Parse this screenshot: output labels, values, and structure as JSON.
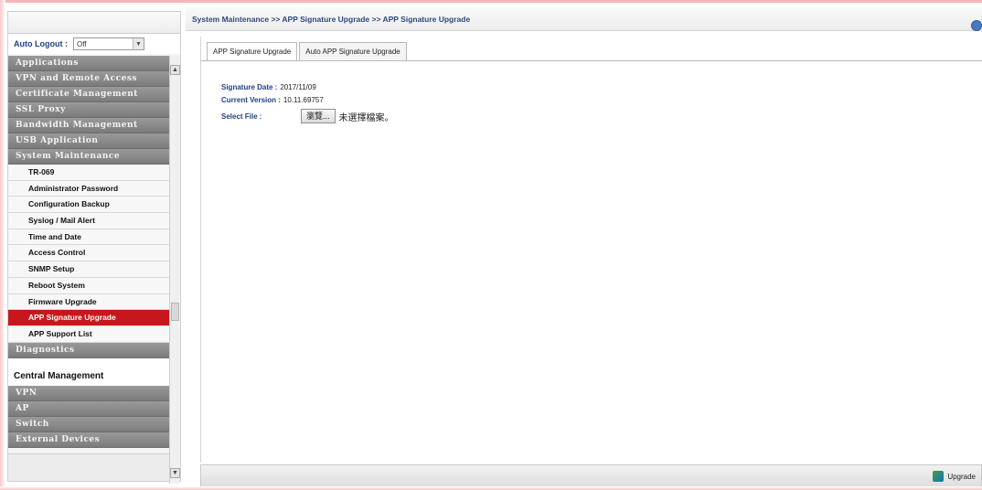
{
  "sidebar": {
    "auto_logout_label": "Auto Logout :",
    "auto_logout_value": "Off",
    "categories_top": [
      "Applications",
      "VPN and Remote Access",
      "Certificate Management",
      "SSL Proxy",
      "Bandwidth Management",
      "USB Application",
      "System Maintenance"
    ],
    "items": [
      "TR-069",
      "Administrator Password",
      "Configuration Backup",
      "Syslog / Mail Alert",
      "Time and Date",
      "Access Control",
      "SNMP Setup",
      "Reboot System",
      "Firmware Upgrade",
      "APP Signature Upgrade",
      "APP Support List"
    ],
    "active_item": "APP Signature Upgrade",
    "diagnostics": "Diagnostics",
    "central_management": "Central Management",
    "categories_bottom": [
      "VPN",
      "AP",
      "Switch",
      "External Devices"
    ]
  },
  "header": {
    "breadcrumb": "System Maintenance >> APP Signature Upgrade >> APP Signature Upgrade"
  },
  "tabs": [
    {
      "label": "APP Signature Upgrade",
      "active": true
    },
    {
      "label": "Auto APP Signature Upgrade",
      "active": false
    }
  ],
  "form": {
    "signature_date_label": "Signature Date :",
    "signature_date_value": "2017/11/09",
    "current_version_label": "Current Version :",
    "current_version_value": "10.11.69757",
    "select_file_label": "Select File :",
    "browse_label": "瀏覽...",
    "no_file_text": "未選擇檔案。"
  },
  "footer": {
    "upgrade_label": "Upgrade"
  },
  "colors": {
    "active_item_bg": "#c8171c",
    "category_bg": "#8a8a8a",
    "label_blue": "#1f3f8a"
  }
}
